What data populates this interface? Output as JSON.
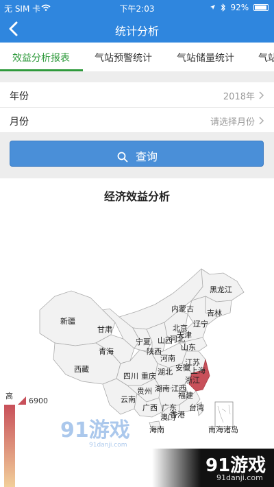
{
  "status_bar": {
    "carrier": "无 SIM 卡",
    "time": "下午2:03",
    "battery": "92%"
  },
  "nav": {
    "title": "统计分析",
    "back_icon": "chevron-left-icon"
  },
  "tabs": [
    {
      "label": "效益分析报表",
      "active": true
    },
    {
      "label": "气站预警统计",
      "active": false
    },
    {
      "label": "气站储量统计",
      "active": false
    },
    {
      "label": "气站",
      "active": false
    }
  ],
  "form": {
    "year": {
      "label": "年份",
      "value": "2018年"
    },
    "month": {
      "label": "月份",
      "value": "请选择月份"
    }
  },
  "query_button": {
    "label": "查询",
    "icon": "search-icon"
  },
  "chart": {
    "title": "经济效益分析",
    "legend_high": "高",
    "legend_value": "6900"
  },
  "colors": {
    "primary": "#2f86de",
    "active_tab": "#2f9a3c",
    "highlight": "#c8505a"
  },
  "map_labels": [
    {
      "name": "黑龙江"
    },
    {
      "name": "吉林"
    },
    {
      "name": "内蒙古"
    },
    {
      "name": "辽宁"
    },
    {
      "name": "新疆"
    },
    {
      "name": "甘肃"
    },
    {
      "name": "北京"
    },
    {
      "name": "天津"
    },
    {
      "name": "宁夏"
    },
    {
      "name": "山西"
    },
    {
      "name": "河北"
    },
    {
      "name": "青海"
    },
    {
      "name": "陕西"
    },
    {
      "name": "山东"
    },
    {
      "name": "河南"
    },
    {
      "name": "江苏"
    },
    {
      "name": "西藏"
    },
    {
      "name": "湖北"
    },
    {
      "name": "安徽"
    },
    {
      "name": "上海"
    },
    {
      "name": "四川"
    },
    {
      "name": "重庆"
    },
    {
      "name": "浙江"
    },
    {
      "name": "贵州"
    },
    {
      "name": "湖南"
    },
    {
      "name": "江西"
    },
    {
      "name": "福建"
    },
    {
      "name": "云南"
    },
    {
      "name": "广西"
    },
    {
      "name": "广东"
    },
    {
      "name": "澳门"
    },
    {
      "name": "香港"
    },
    {
      "name": "台湾"
    },
    {
      "name": "海南"
    },
    {
      "name": "南海诸岛"
    }
  ],
  "watermarks": {
    "top_brand": "91游戏",
    "top_url": "91danji.com",
    "bottom_brand": "91游戏",
    "bottom_url": "91danji.com"
  }
}
